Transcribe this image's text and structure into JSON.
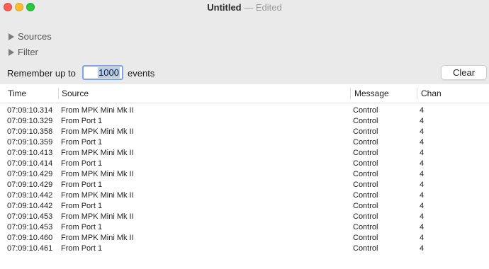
{
  "window": {
    "title": "Untitled",
    "separator": "—",
    "status": "Edited"
  },
  "disclosures": {
    "sources": "Sources",
    "filter": "Filter"
  },
  "memory": {
    "label": "Remember up to",
    "value": "1000",
    "suffix": "events"
  },
  "clear_button": "Clear",
  "table": {
    "columns": [
      "Time",
      "Source",
      "Message",
      "Chan"
    ],
    "rows": [
      {
        "time": "07:09:10.314",
        "source": "From MPK Mini Mk II",
        "message": "Control",
        "chan": "4"
      },
      {
        "time": "07:09:10.329",
        "source": "From Port 1",
        "message": "Control",
        "chan": "4"
      },
      {
        "time": "07:09:10.358",
        "source": "From MPK Mini Mk II",
        "message": "Control",
        "chan": "4"
      },
      {
        "time": "07:09:10.359",
        "source": "From Port 1",
        "message": "Control",
        "chan": "4"
      },
      {
        "time": "07:09:10.413",
        "source": "From MPK Mini Mk II",
        "message": "Control",
        "chan": "4"
      },
      {
        "time": "07:09:10.414",
        "source": "From Port 1",
        "message": "Control",
        "chan": "4"
      },
      {
        "time": "07:09:10.429",
        "source": "From MPK Mini Mk II",
        "message": "Control",
        "chan": "4"
      },
      {
        "time": "07:09:10.429",
        "source": "From Port 1",
        "message": "Control",
        "chan": "4"
      },
      {
        "time": "07:09:10.442",
        "source": "From MPK Mini Mk II",
        "message": "Control",
        "chan": "4"
      },
      {
        "time": "07:09:10.442",
        "source": "From Port 1",
        "message": "Control",
        "chan": "4"
      },
      {
        "time": "07:09:10.453",
        "source": "From MPK Mini Mk II",
        "message": "Control",
        "chan": "4"
      },
      {
        "time": "07:09:10.453",
        "source": "From Port 1",
        "message": "Control",
        "chan": "4"
      },
      {
        "time": "07:09:10.460",
        "source": "From MPK Mini Mk II",
        "message": "Control",
        "chan": "4"
      },
      {
        "time": "07:09:10.461",
        "source": "From Port 1",
        "message": "Control",
        "chan": "4"
      }
    ]
  }
}
